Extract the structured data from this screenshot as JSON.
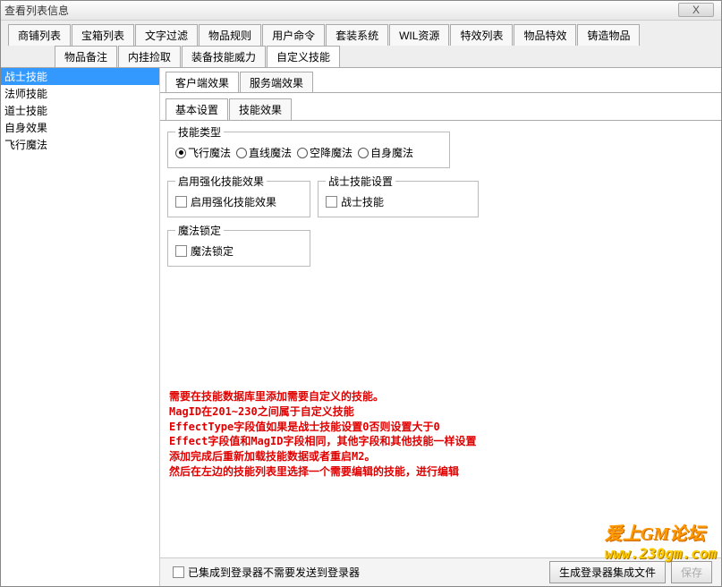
{
  "window": {
    "title": "查看列表信息",
    "close": "X"
  },
  "tabs1": {
    "t0": "商铺列表",
    "t1": "宝箱列表",
    "t2": "文字过滤",
    "t3": "物品规则",
    "t4": "用户命令",
    "t5": "套装系统",
    "t6": "WIL资源",
    "t7": "特效列表",
    "t8": "物品特效",
    "t9": "铸造物品"
  },
  "tabs2": {
    "t0": "物品备注",
    "t1": "内挂捡取",
    "t2": "装备技能威力",
    "t3": "自定义技能"
  },
  "sidebar": {
    "i0": "战士技能",
    "i1": "法师技能",
    "i2": "道士技能",
    "i3": "自身效果",
    "i4": "飞行魔法"
  },
  "subtabs": {
    "t0": "客户端效果",
    "t1": "服务端效果"
  },
  "subtabs2": {
    "t0": "基本设置",
    "t1": "技能效果"
  },
  "group_skill_type": {
    "legend": "技能类型",
    "r0": "飞行魔法",
    "r1": "直线魔法",
    "r2": "空降魔法",
    "r3": "自身魔法"
  },
  "group_enhance": {
    "legend": "启用强化技能效果",
    "chk": "启用强化技能效果"
  },
  "group_warrior": {
    "legend": "战士技能设置",
    "chk": "战士技能"
  },
  "group_lock": {
    "legend": "魔法锁定",
    "chk": "魔法锁定"
  },
  "redtext": "需要在技能数据库里添加需要自定义的技能。\nMagID在201~230之间属于自定义技能\nEffectType字段值如果是战士技能设置0否则设置大于0\nEffect字段值和MagID字段相同，其他字段和其他技能一样设置\n添加完成后重新加载技能数据或者重启M2。\n然后在左边的技能列表里选择一个需要编辑的技能，进行编辑",
  "footer": {
    "chk": "已集成到登录器不需要发送到登录器",
    "btn_gen": "生成登录器集成文件",
    "btn_save": "保存"
  },
  "watermark": {
    "line1": "爱上GM论坛",
    "line2": "www.230gm.com"
  }
}
